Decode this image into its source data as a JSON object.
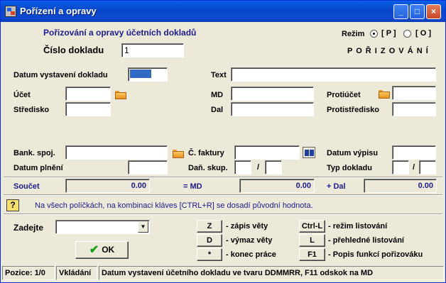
{
  "window": {
    "title": "Pořízení a opravy"
  },
  "header": {
    "heading": "Pořizování a opravy účetních dokladů",
    "doc_number_label": "Číslo dokladu",
    "doc_number_value": "1",
    "mode_label": "Režim",
    "mode_p": "[ P ]",
    "mode_o": "[ O ]",
    "mode_state": "P O Ř I Z O V Á N Í"
  },
  "form": {
    "datum_vystaveni_label": "Datum vystavení dokladu",
    "text_label": "Text",
    "ucet_label": "Účet",
    "md_label": "MD",
    "protiucet_label": "Protiúčet",
    "stredisko_label": "Středisko",
    "dal_label": "Dal",
    "protistredisko_label": "Protistředisko",
    "bank_spoj_label": "Bank. spoj.",
    "c_faktury_label": "Č. faktury",
    "datum_vypisu_label": "Datum výpisu",
    "datum_plneni_label": "Datum plnění",
    "dan_skup_label": "Daň. skup.",
    "slash": "/",
    "typ_dokladu_label": "Typ dokladu"
  },
  "totals": {
    "soucet_label": "Součet",
    "soucet_value": "0.00",
    "md_label": "= MD",
    "md_value": "0.00",
    "dal_label": "+ Dal",
    "dal_value": "0.00"
  },
  "hint": {
    "icon": "?",
    "text": "Na všech políčkách, na kombinaci kláves [CTRL+R] se dosadí původní hodnota."
  },
  "bottom": {
    "zadejte_label": "Zadejte",
    "ok_label": "OK",
    "keys": [
      {
        "key": "Z",
        "desc": "- zápis věty"
      },
      {
        "key": "D",
        "desc": "- výmaz věty"
      },
      {
        "key": "*",
        "desc": "- konec práce"
      },
      {
        "key": "Ctrl-L",
        "desc": "- režim listování"
      },
      {
        "key": "L",
        "desc": "- přehledné listování"
      },
      {
        "key": "F1",
        "desc": "- Popis funkcí pořizováku"
      }
    ]
  },
  "status": {
    "position": "Pozice: 1/0",
    "mode": "Vkládání",
    "message": "Datum vystavení účetního dokladu ve tvaru DDMMRR, F11 odskok na MD"
  },
  "colors": {
    "accent": "#1c1c8c",
    "titlebar": "#0a5fe8",
    "selection": "#316ac5"
  }
}
